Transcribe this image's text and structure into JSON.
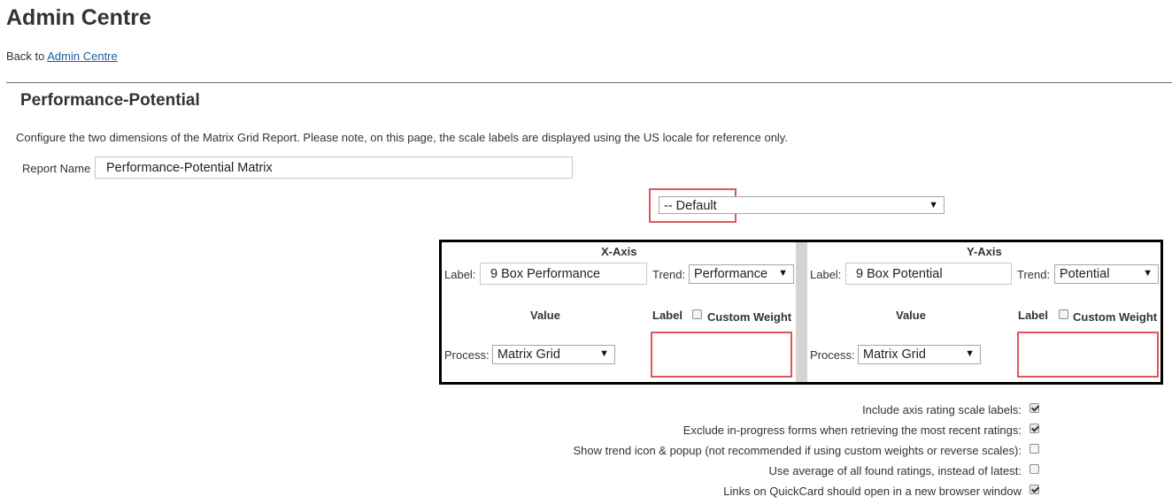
{
  "header": {
    "title": "Admin Centre",
    "back_prefix": "Back to",
    "back_link": "Admin Centre"
  },
  "section": {
    "title": "Performance-Potential",
    "description": "Configure the two dimensions of the Matrix Grid Report. Please note, on this page, the scale labels are displayed using the US locale for reference only."
  },
  "report_name": {
    "label": "Report Name",
    "value": "Performance-Potential Matrix"
  },
  "default_select": {
    "value": "-- Default"
  },
  "x_axis": {
    "title": "X-Axis",
    "label_caption": "Label:",
    "label_value": "9 Box Performance",
    "trend_caption": "Trend:",
    "trend_value": "Performance",
    "value_header": "Value",
    "label_header": "Label",
    "custom_weight": "Custom Weight",
    "process_caption": "Process:",
    "process_value": "Matrix Grid"
  },
  "y_axis": {
    "title": "Y-Axis",
    "label_caption": "Label:",
    "label_value": "9 Box Potential",
    "trend_caption": "Trend:",
    "trend_value": "Potential",
    "value_header": "Value",
    "label_header": "Label",
    "custom_weight": "Custom Weight",
    "process_caption": "Process:",
    "process_value": "Matrix Grid"
  },
  "options": [
    {
      "label": "Include axis rating scale labels:",
      "checked": true
    },
    {
      "label": "Exclude in-progress forms when retrieving the most recent ratings:",
      "checked": true
    },
    {
      "label": "Show trend icon & popup (not recommended if using custom weights or reverse scales):",
      "checked": false
    },
    {
      "label": "Use average of all found ratings, instead of latest:",
      "checked": false
    },
    {
      "label": "Links on QuickCard should open in a new browser window",
      "checked": true
    }
  ],
  "icons": {
    "dropdown_arrow": "▼"
  },
  "colors": {
    "link": "#1f5c99",
    "highlight": "#e0565a"
  }
}
